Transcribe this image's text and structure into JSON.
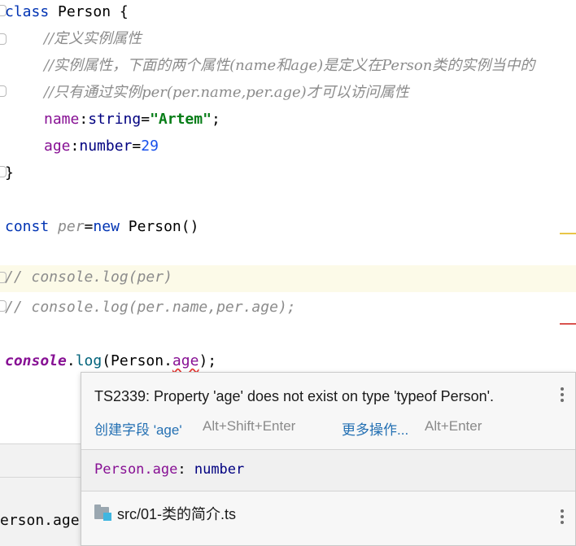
{
  "editor": {
    "lines": {
      "l1": {
        "kw": "class",
        "name": " Person {"
      },
      "l2": {
        "comment": "//定义实例属性"
      },
      "l3": {
        "comment": "//实例属性，下面的两个属性(name和age)是定义在Person类的实例当中的"
      },
      "l4": {
        "comment": "//只有通过实例per(per.name,per.age)才可以访问属性"
      },
      "l5": {
        "prop": "name",
        "colon": ":",
        "type": "string",
        "eq": "=",
        "value": "\"Artem\"",
        "semi": ";"
      },
      "l6": {
        "prop": "age",
        "colon": ":",
        "type": "number",
        "eq": "=",
        "value": "29"
      },
      "l7": {
        "text": "}"
      },
      "l9": {
        "kw": "const",
        "var": "per",
        "eq": "=",
        "new": "new",
        "call": " Person()"
      },
      "l11": {
        "comment": "// console.log(per)"
      },
      "l12": {
        "comment": "// console.log(per.name,per.age);"
      },
      "l14": {
        "console": "console",
        "dot": ".",
        "method": "log",
        "open": "(Person.",
        "err": "age",
        "close": ");"
      }
    }
  },
  "bottom_panel": {
    "text": "erson.age)"
  },
  "popup": {
    "error_message": "TS2339: Property 'age' does not exist on type 'typeof Person'.",
    "action_create_field": "创建字段 'age'",
    "action_create_field_shortcut": "Alt+Shift+Enter",
    "action_more": "更多操作...",
    "action_more_shortcut": "Alt+Enter",
    "signature_name": "Person.age",
    "signature_colon": ": ",
    "signature_type": "number",
    "file_path": "src/01-类的简介.ts",
    "icons": {
      "menu": "more-vert-icon",
      "file": "ts-file-icon"
    }
  },
  "colors": {
    "keyword": "#0033b3",
    "property": "#871094",
    "string": "#067d17",
    "number": "#1750eb",
    "comment": "#8c8c8c",
    "link": "#2470b3",
    "marker_warning": "#e8c547",
    "marker_error": "#d9534f"
  }
}
